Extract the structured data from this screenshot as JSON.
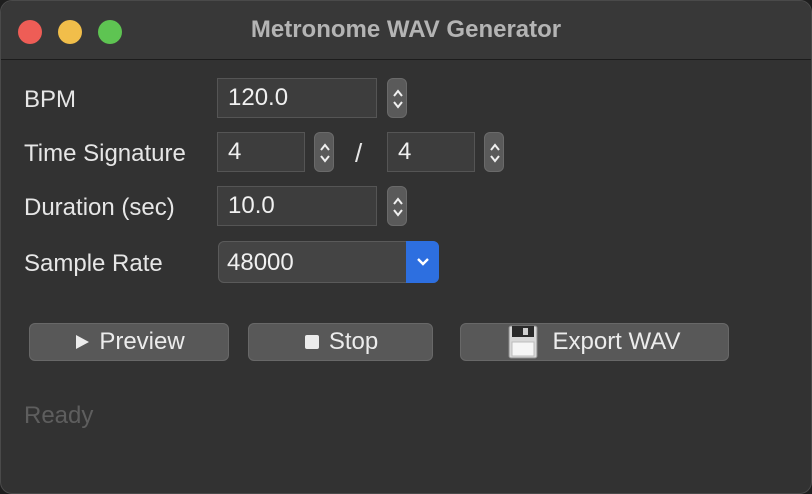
{
  "window": {
    "title": "Metronome WAV Generator"
  },
  "form": {
    "bpm": {
      "label": "BPM",
      "value": "120.0"
    },
    "time_signature": {
      "label": "Time Signature",
      "numerator": "4",
      "separator": "/",
      "denominator": "4"
    },
    "duration": {
      "label": "Duration (sec)",
      "value": "10.0"
    },
    "sample_rate": {
      "label": "Sample Rate",
      "value": "48000"
    }
  },
  "buttons": {
    "preview": {
      "label": "Preview",
      "icon": "play-icon"
    },
    "stop": {
      "label": "Stop",
      "icon": "stop-icon"
    },
    "export": {
      "label": "Export WAV",
      "icon": "floppy-disk-icon"
    }
  },
  "status": {
    "text": "Ready"
  },
  "colors": {
    "accent": "#2d6fe0",
    "close": "#ee5d56",
    "minimize": "#f1be4a",
    "maximize": "#5ec452"
  }
}
